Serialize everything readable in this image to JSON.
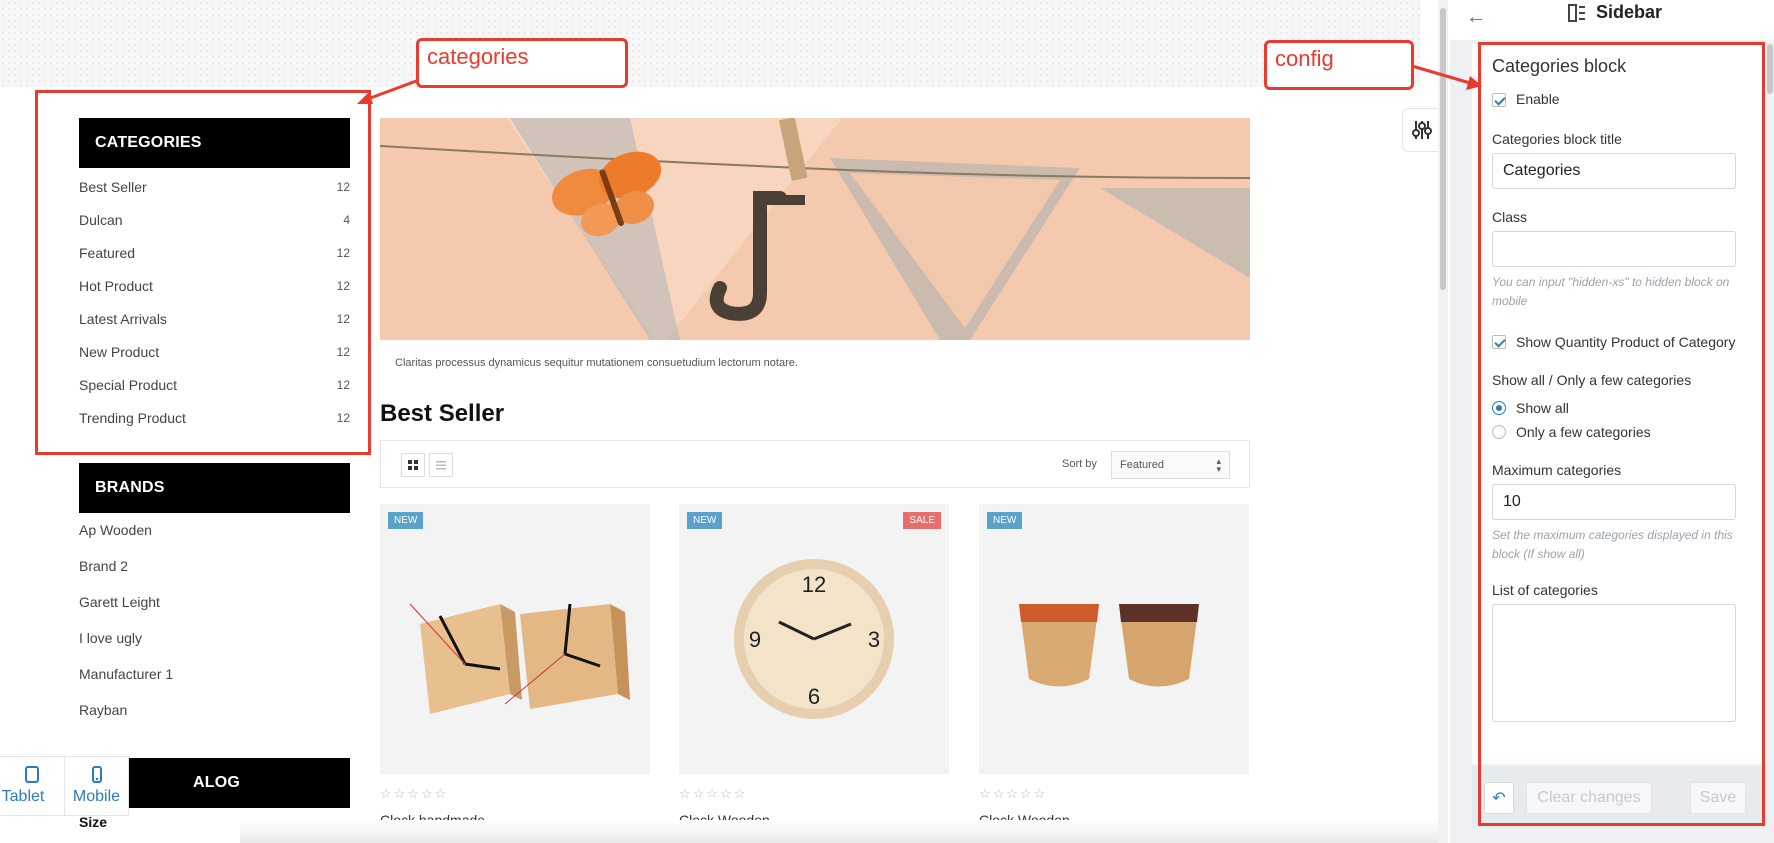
{
  "annotations": {
    "categories": "categories",
    "config": "config"
  },
  "categories_block": {
    "title": "CATEGORIES",
    "items": [
      {
        "name": "Best Seller",
        "count": "12"
      },
      {
        "name": "Dulcan",
        "count": "4"
      },
      {
        "name": "Featured",
        "count": "12"
      },
      {
        "name": "Hot Product",
        "count": "12"
      },
      {
        "name": "Latest Arrivals",
        "count": "12"
      },
      {
        "name": "New Product",
        "count": "12"
      },
      {
        "name": "Special Product",
        "count": "12"
      },
      {
        "name": "Trending Product",
        "count": "12"
      }
    ]
  },
  "brands_block": {
    "title": "BRANDS",
    "items": [
      "Ap Wooden",
      "Brand 2",
      "Garett Leight",
      "I love ugly",
      "Manufacturer 1",
      "Rayban"
    ]
  },
  "catalog_block": {
    "title_partial": "ALOG",
    "size_label": "Size"
  },
  "banner": {
    "caption": "Claritas processus dynamicus sequitur mutationem consuetudium lectorum notare."
  },
  "section": {
    "title": "Best Seller"
  },
  "toolbar": {
    "sort_label": "Sort by",
    "sort_value": "Featured"
  },
  "products": [
    {
      "badges": [
        "NEW"
      ],
      "name": "Clock handmade"
    },
    {
      "badges": [
        "NEW",
        "SALE"
      ],
      "name": "Clock Wooden"
    },
    {
      "badges": [
        "NEW"
      ],
      "name": "Clock Wooden"
    }
  ],
  "device_switch": {
    "tablet": "Tablet",
    "mobile": "Mobile"
  },
  "panel": {
    "title": "Sidebar",
    "block_title": "Categories block",
    "enable_label": "Enable",
    "enable_checked": true,
    "block_title_label": "Categories block title",
    "block_title_value": "Categories",
    "class_label": "Class",
    "class_value": "",
    "class_hint": "You can input \"hidden-xs\" to hidden block on mobile",
    "show_qty_label": "Show Quantity Product of Category",
    "show_qty_checked": true,
    "show_mode_label": "Show all / Only a few categories",
    "show_all_label": "Show all",
    "only_few_label": "Only a few categories",
    "selected_mode": "Show all",
    "max_label": "Maximum categories",
    "max_value": "10",
    "max_hint": "Set the maximum categories displayed in this block (If show all)",
    "list_label": "List of categories",
    "clear_label": "Clear changes",
    "save_label": "Save"
  },
  "colors": {
    "accent": "#2a7bbf",
    "annotation": "#e63b2e",
    "badge_new": "#5aa2c9",
    "badge_sale": "#e86d6d"
  }
}
